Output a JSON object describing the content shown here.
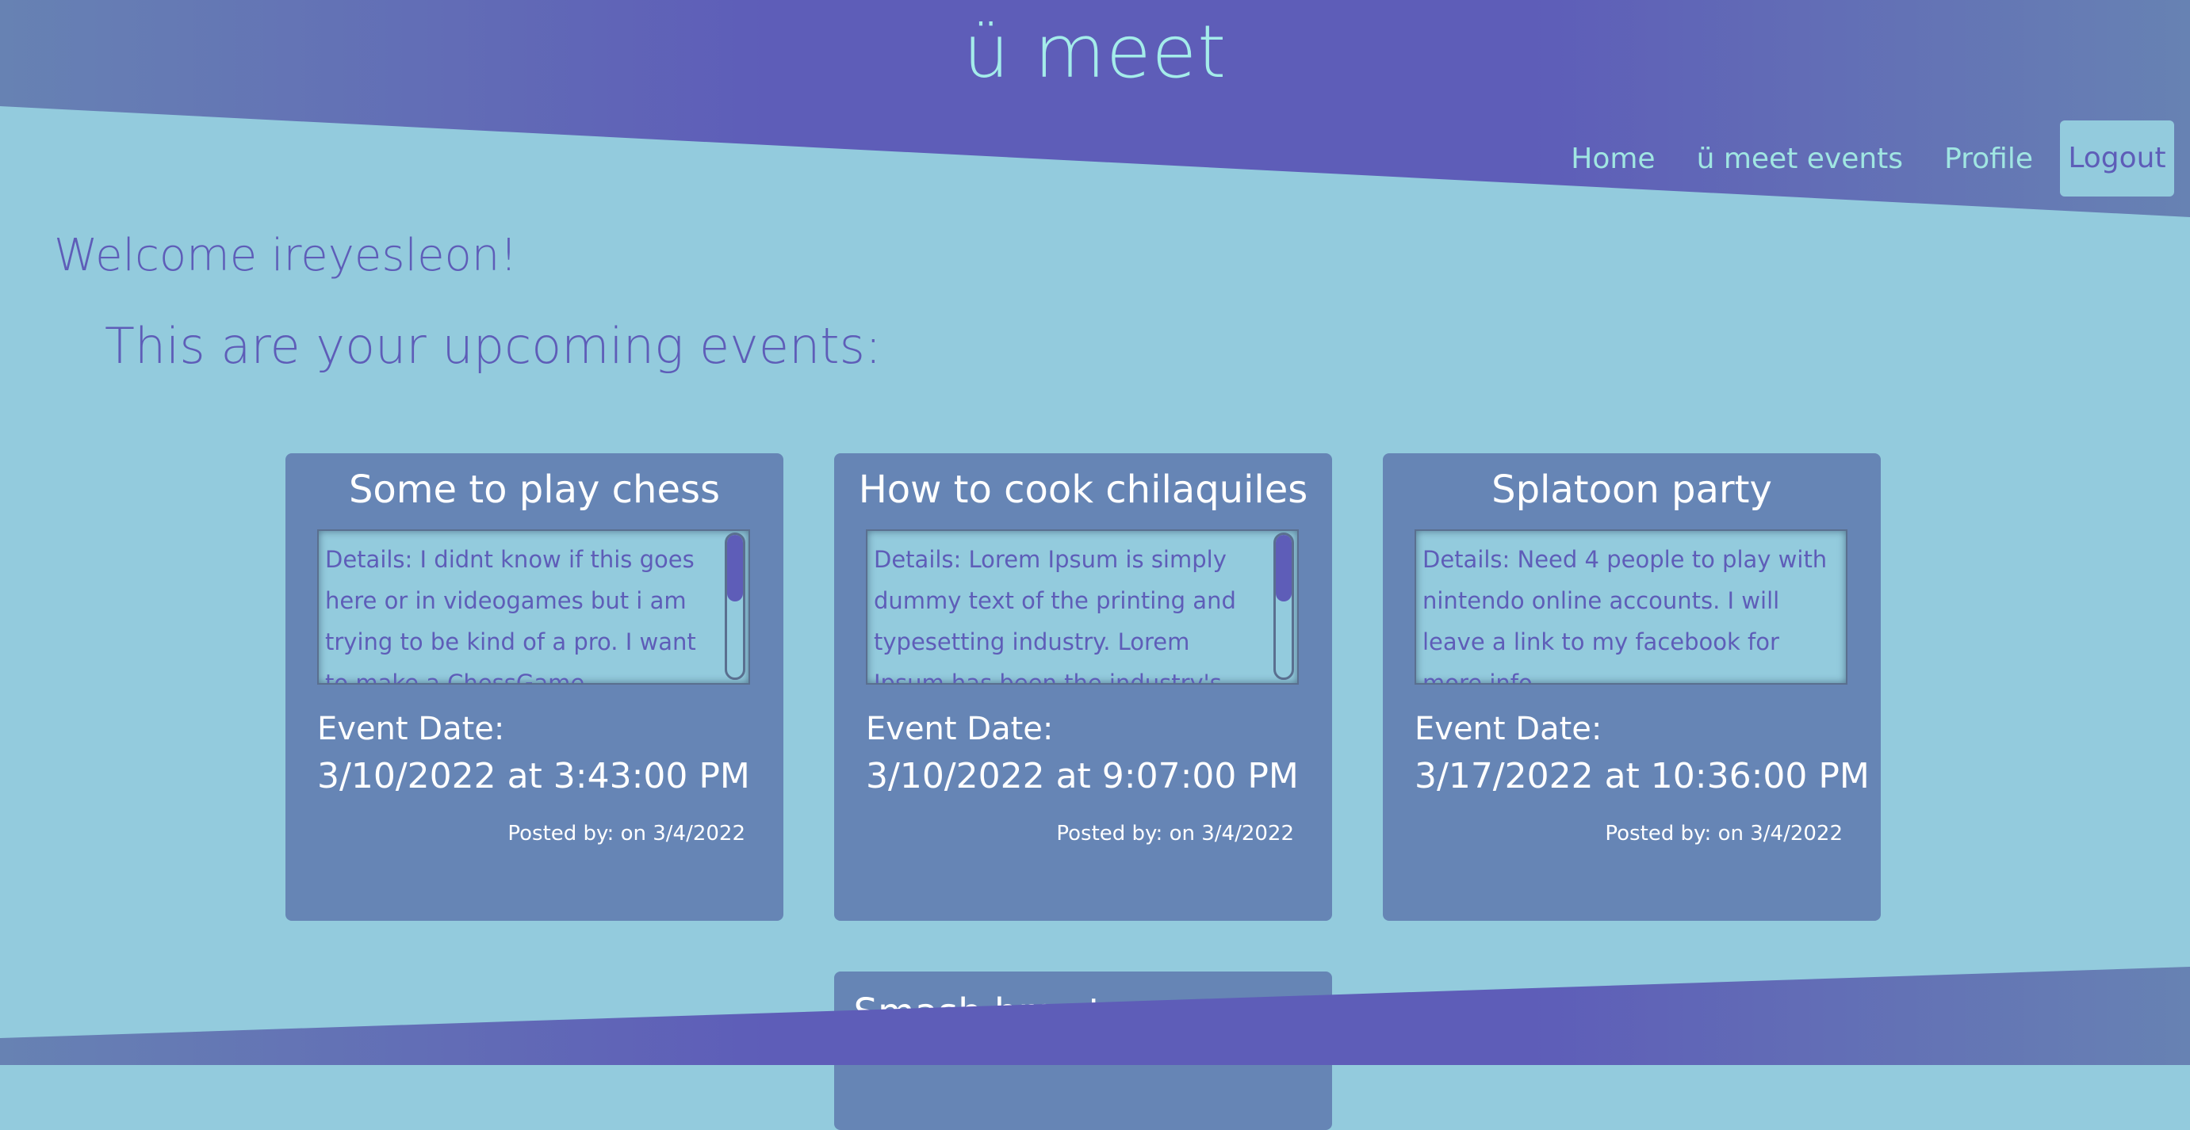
{
  "brand": "ü meet",
  "nav": {
    "home": "Home",
    "events": "ü meet events",
    "profile": "Profile",
    "logout": "Logout"
  },
  "welcome": "Welcome ireyesleon!",
  "subheading": "This are your upcoming events:",
  "events": [
    {
      "title": "Some to play chess",
      "details": "Details: I didnt know if this goes here or in videogames but i am trying to be kind of a pro. I want to make a ChessGame tournament. The prize",
      "date_label": "Event Date:",
      "date": "3/10/2022 at 3:43:00 PM",
      "posted": "Posted by: on 3/4/2022"
    },
    {
      "title": "How to cook chilaquiles",
      "details": "Details: Lorem Ipsum is simply dummy text of the printing and typesetting industry. Lorem Ipsum has been the industry's standard",
      "date_label": "Event Date:",
      "date": "3/10/2022 at 9:07:00 PM",
      "posted": "Posted by: on 3/4/2022"
    },
    {
      "title": "Splatoon party",
      "details": "Details: Need 4 people to play with nintendo online accounts. I will leave a link to my facebook for more info",
      "date_label": "Event Date:",
      "date": "3/17/2022 at 10:36:00 PM",
      "posted": "Posted by: on 3/4/2022"
    },
    {
      "title": "Smash bros tournament"
    }
  ],
  "colors": {
    "background": "#93cbdd",
    "band": "#5e5db8",
    "card": "#6685b5",
    "brand_text": "#a4ecea"
  }
}
